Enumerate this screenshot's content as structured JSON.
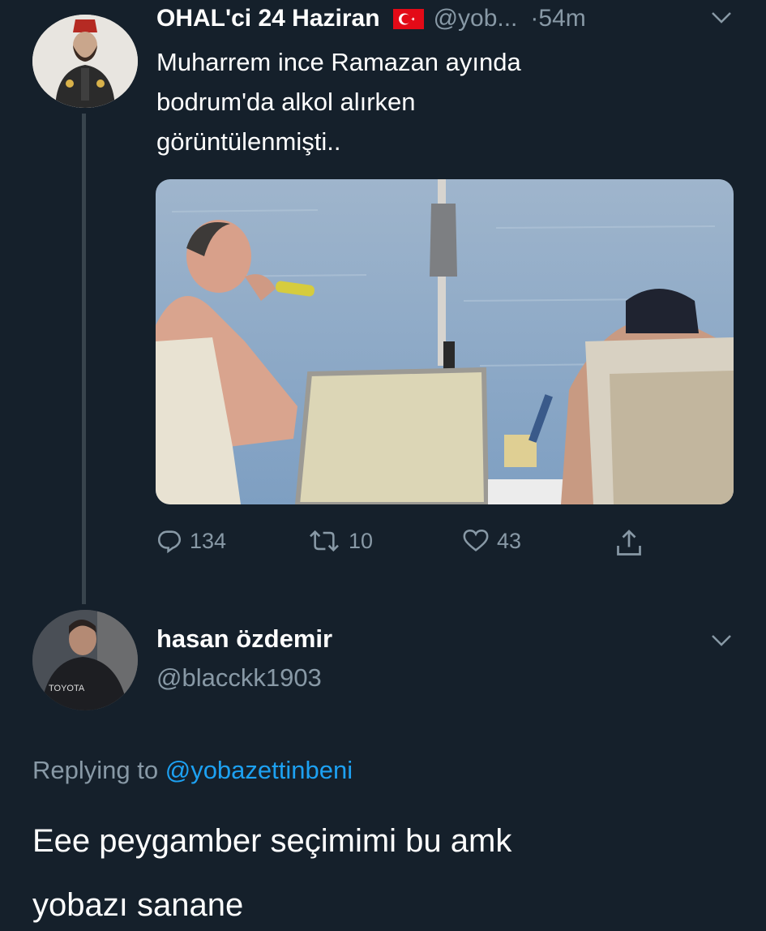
{
  "original_tweet": {
    "display_name": "OHAL'ci 24 Haziran",
    "flag_icon": "turkey-flag-icon",
    "handle": "@yob...",
    "time": "·54m",
    "text_lines": [
      "Muharrem ince Ramazan ayında",
      "bodrum'da alkol alırken",
      "görüntülenmişti.."
    ],
    "media_icon": "photo-man-drinking-on-beach",
    "actions": {
      "reply_count": "134",
      "retweet_count": "10",
      "like_count": "43"
    }
  },
  "reply_tweet": {
    "display_name": "hasan özdemir",
    "handle": "@blacckk1903",
    "replying_prefix": "Replying to",
    "replying_to": "@yobazettinbeni",
    "text_lines": [
      "Eee peygamber seçimimi bu amk",
      "yobazı sanane"
    ]
  },
  "colors": {
    "background": "#15202b",
    "secondary_text": "#8899a6",
    "link": "#1da1f2",
    "thread_line": "#38444d"
  }
}
